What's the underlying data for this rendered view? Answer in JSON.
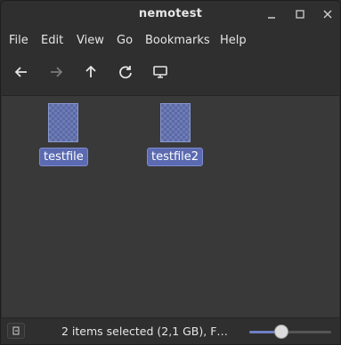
{
  "window": {
    "title": "nemotest"
  },
  "menu": [
    "File",
    "Edit",
    "View",
    "Go",
    "Bookmarks",
    "Help"
  ],
  "toolbar": {
    "icons": [
      "back-arrow-icon",
      "forward-arrow-icon",
      "up-arrow-icon",
      "reload-icon",
      "computer-icon"
    ]
  },
  "files": [
    {
      "name": "testfile",
      "selected": true
    },
    {
      "name": "testfile2",
      "selected": true
    }
  ],
  "status": {
    "text": "2 items selected (2,1 GB), F…",
    "zoom_level": 0.37
  },
  "colors": {
    "selection": "#5b6ab1",
    "background": "#393939",
    "chrome": "#2f2f2f"
  }
}
